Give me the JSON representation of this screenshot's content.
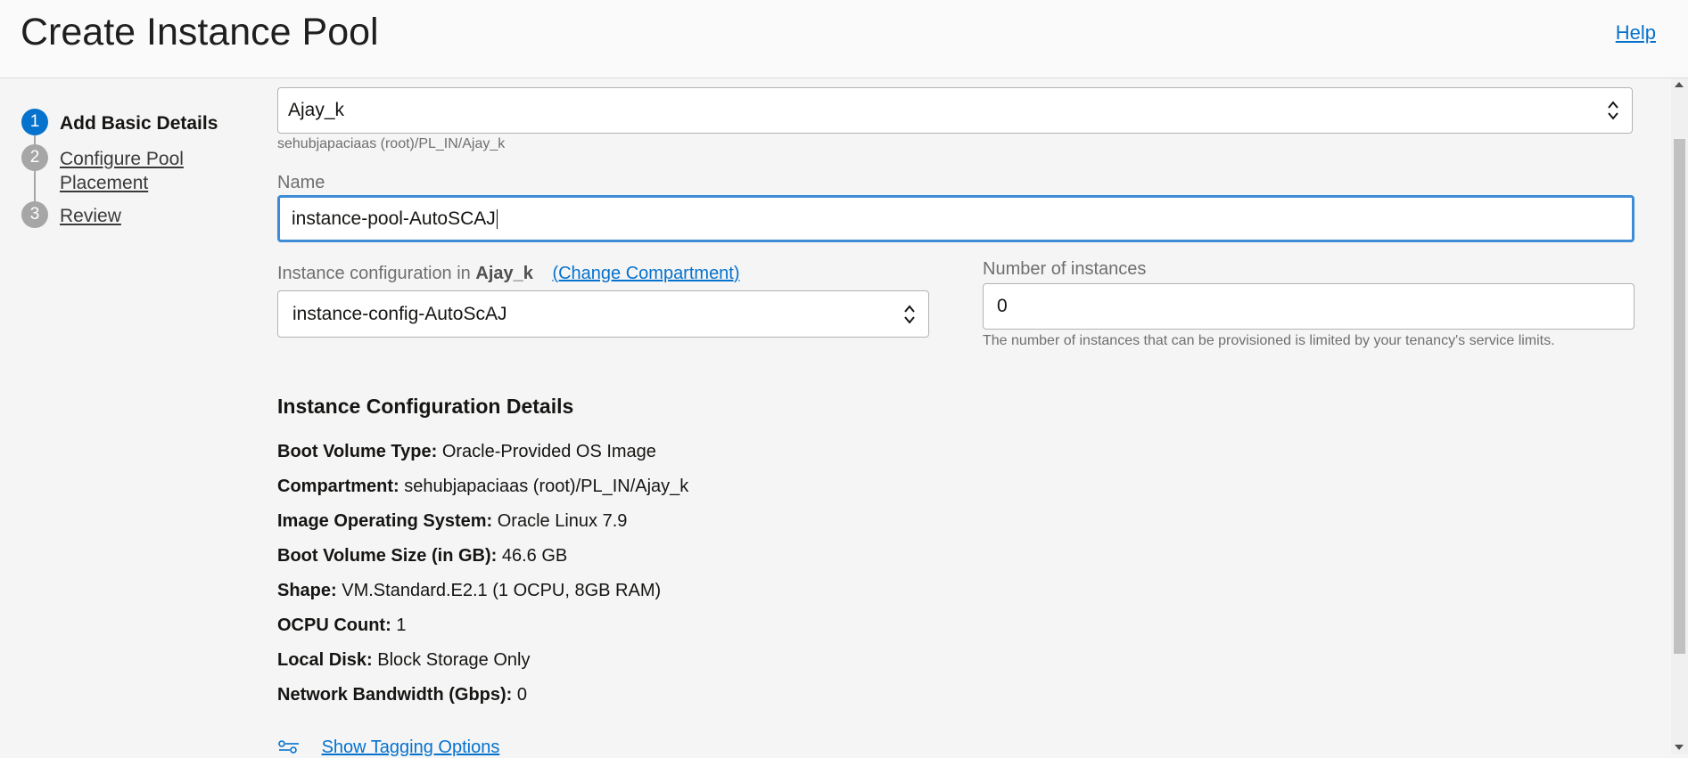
{
  "header": {
    "title": "Create Instance Pool",
    "help_label": "Help"
  },
  "steps": [
    {
      "number": "1",
      "label": "Add Basic Details",
      "active": true
    },
    {
      "number": "2",
      "label": "Configure Pool Placement",
      "active": false
    },
    {
      "number": "3",
      "label": "Review",
      "active": false
    }
  ],
  "compartment": {
    "value": "Ajay_k",
    "path": "sehubjapaciaas (root)/PL_IN/Ajay_k"
  },
  "name": {
    "label": "Name",
    "value": "instance-pool-AutoSCAJ"
  },
  "instance_config": {
    "label_prefix": "Instance configuration in",
    "compartment": "Ajay_k",
    "change_link": "(Change Compartment)",
    "value": "instance-config-AutoScAJ"
  },
  "instances": {
    "label": "Number of instances",
    "value": "0",
    "help": "The number of instances that can be provisioned is limited by your tenancy's service limits."
  },
  "details": {
    "title": "Instance Configuration Details",
    "items": [
      {
        "key": "Boot Volume Type:",
        "value": "Oracle-Provided OS Image"
      },
      {
        "key": "Compartment:",
        "value": "sehubjapaciaas (root)/PL_IN/Ajay_k"
      },
      {
        "key": "Image Operating System:",
        "value": "Oracle Linux 7.9"
      },
      {
        "key": "Boot Volume Size (in GB):",
        "value": "46.6 GB"
      },
      {
        "key": "Shape:",
        "value": "VM.Standard.E2.1 (1 OCPU, 8GB RAM)"
      },
      {
        "key": "OCPU Count:",
        "value": "1"
      },
      {
        "key": "Local Disk:",
        "value": "Block Storage Only"
      },
      {
        "key": "Network Bandwidth (Gbps):",
        "value": "0"
      }
    ]
  },
  "tagging": {
    "label": "Show Tagging Options",
    "icon": "tag-options-icon"
  },
  "colors": {
    "accent": "#0572ce",
    "focus_border": "#3e8bd6",
    "step_inactive": "#a6a6a6"
  }
}
